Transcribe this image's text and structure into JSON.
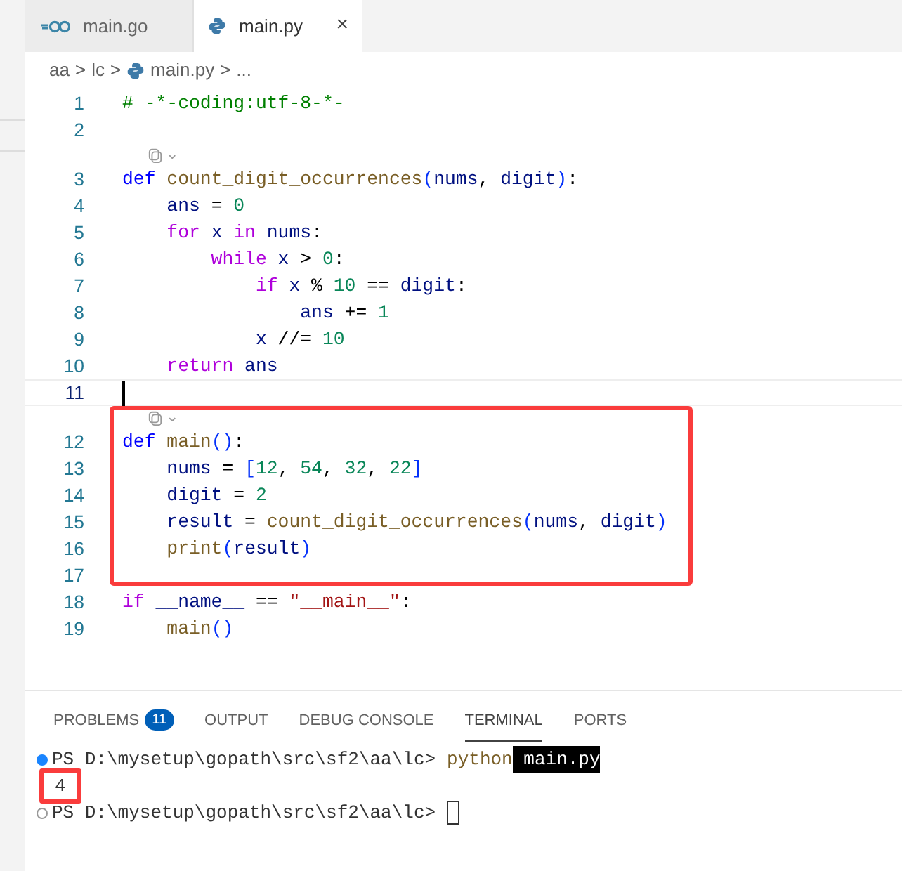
{
  "tabs": [
    {
      "label": "main.go",
      "selected": false
    },
    {
      "label": "main.py",
      "selected": true,
      "close": "×"
    }
  ],
  "breadcrumb": [
    {
      "label": "aa",
      "kind": "folder"
    },
    {
      "label": "lc",
      "kind": "folder"
    },
    {
      "label": "main.py",
      "kind": "file"
    },
    {
      "label": "...",
      "kind": "symbol"
    }
  ],
  "breadcrumb_separator": ">",
  "code": [
    {
      "highlighted": false,
      "lines": [
        {
          "kind": "line",
          "number": "1",
          "current": false,
          "tokens": [
            {
              "t": "# -*-coding:utf-8-*-",
              "color": "#008000"
            }
          ]
        },
        {
          "kind": "line",
          "number": "2",
          "current": false
        },
        {
          "kind": "codelens",
          "caret": "⌄"
        },
        {
          "kind": "line",
          "number": "3",
          "current": false,
          "tokens": [
            {
              "t": "def",
              "color": "#0000ff"
            },
            {
              "t": " count_digit_occurrences",
              "color": "#795e26"
            },
            {
              "t": "(",
              "color": "#0431fa"
            },
            {
              "t": "nums",
              "color": "#001080"
            },
            {
              "t": ", ",
              "color": "#000000"
            },
            {
              "t": "digit",
              "color": "#001080"
            },
            {
              "t": ")",
              "color": "#0431fa"
            },
            {
              "t": ":",
              "color": "#000000"
            }
          ]
        },
        {
          "kind": "line",
          "number": "4",
          "current": false,
          "tokens": [
            {
              "t": "    ans",
              "color": "#001080"
            },
            {
              "t": " = ",
              "color": "#000000"
            },
            {
              "t": "0",
              "color": "#098658"
            }
          ]
        },
        {
          "kind": "line",
          "number": "5",
          "current": false,
          "tokens": [
            {
              "t": "    for",
              "color": "#af00db"
            },
            {
              "t": " x",
              "color": "#001080"
            },
            {
              "t": " in",
              "color": "#af00db"
            },
            {
              "t": " nums",
              "color": "#001080"
            },
            {
              "t": ":",
              "color": "#000000"
            }
          ]
        },
        {
          "kind": "line",
          "number": "6",
          "current": false,
          "tokens": [
            {
              "t": "        while",
              "color": "#af00db"
            },
            {
              "t": " x",
              "color": "#001080"
            },
            {
              "t": " > ",
              "color": "#000000"
            },
            {
              "t": "0",
              "color": "#098658"
            },
            {
              "t": ":",
              "color": "#000000"
            }
          ]
        },
        {
          "kind": "line",
          "number": "7",
          "current": false,
          "tokens": [
            {
              "t": "            if",
              "color": "#af00db"
            },
            {
              "t": " x",
              "color": "#001080"
            },
            {
              "t": " % ",
              "color": "#000000"
            },
            {
              "t": "10",
              "color": "#098658"
            },
            {
              "t": " == ",
              "color": "#000000"
            },
            {
              "t": "digit",
              "color": "#001080"
            },
            {
              "t": ":",
              "color": "#000000"
            }
          ]
        },
        {
          "kind": "line",
          "number": "8",
          "current": false,
          "tokens": [
            {
              "t": "                ans",
              "color": "#001080"
            },
            {
              "t": " += ",
              "color": "#000000"
            },
            {
              "t": "1",
              "color": "#098658"
            }
          ]
        },
        {
          "kind": "line",
          "number": "9",
          "current": false,
          "tokens": [
            {
              "t": "            x",
              "color": "#001080"
            },
            {
              "t": " //= ",
              "color": "#000000"
            },
            {
              "t": "10",
              "color": "#098658"
            }
          ]
        },
        {
          "kind": "line",
          "number": "10",
          "current": false,
          "tokens": [
            {
              "t": "    return",
              "color": "#af00db"
            },
            {
              "t": " ans",
              "color": "#001080"
            }
          ]
        },
        {
          "kind": "line",
          "number": "11",
          "current": true
        }
      ]
    },
    {
      "highlighted": true,
      "lines": [
        {
          "kind": "codelens",
          "caret": "⌄"
        },
        {
          "kind": "line",
          "number": "12",
          "current": false,
          "tokens": [
            {
              "t": "def",
              "color": "#0000ff"
            },
            {
              "t": " main",
              "color": "#795e26"
            },
            {
              "t": "()",
              "color": "#0431fa"
            },
            {
              "t": ":",
              "color": "#000000"
            }
          ]
        },
        {
          "kind": "line",
          "number": "13",
          "current": false,
          "tokens": [
            {
              "t": "    nums",
              "color": "#001080"
            },
            {
              "t": " = ",
              "color": "#000000"
            },
            {
              "t": "[",
              "color": "#0431fa"
            },
            {
              "t": "12",
              "color": "#098658"
            },
            {
              "t": ", ",
              "color": "#000000"
            },
            {
              "t": "54",
              "color": "#098658"
            },
            {
              "t": ", ",
              "color": "#000000"
            },
            {
              "t": "32",
              "color": "#098658"
            },
            {
              "t": ", ",
              "color": "#000000"
            },
            {
              "t": "22",
              "color": "#098658"
            },
            {
              "t": "]",
              "color": "#0431fa"
            }
          ]
        },
        {
          "kind": "line",
          "number": "14",
          "current": false,
          "tokens": [
            {
              "t": "    digit",
              "color": "#001080"
            },
            {
              "t": " = ",
              "color": "#000000"
            },
            {
              "t": "2",
              "color": "#098658"
            }
          ]
        },
        {
          "kind": "line",
          "number": "15",
          "current": false,
          "tokens": [
            {
              "t": "    result",
              "color": "#001080"
            },
            {
              "t": " = ",
              "color": "#000000"
            },
            {
              "t": "count_digit_occurrences",
              "color": "#795e26"
            },
            {
              "t": "(",
              "color": "#0431fa"
            },
            {
              "t": "nums",
              "color": "#001080"
            },
            {
              "t": ", ",
              "color": "#000000"
            },
            {
              "t": "digit",
              "color": "#001080"
            },
            {
              "t": ")",
              "color": "#0431fa"
            }
          ]
        },
        {
          "kind": "line",
          "number": "16",
          "current": false,
          "tokens": [
            {
              "t": "    print",
              "color": "#795e26"
            },
            {
              "t": "(",
              "color": "#0431fa"
            },
            {
              "t": "result",
              "color": "#001080"
            },
            {
              "t": ")",
              "color": "#0431fa"
            }
          ]
        },
        {
          "kind": "line",
          "number": "17",
          "current": false
        }
      ]
    },
    {
      "highlighted": false,
      "lines": [
        {
          "kind": "line",
          "number": "18",
          "current": false,
          "tokens": [
            {
              "t": "if",
              "color": "#af00db"
            },
            {
              "t": " __name__",
              "color": "#001080"
            },
            {
              "t": " == ",
              "color": "#000000"
            },
            {
              "t": "\"__main__\"",
              "color": "#a31515"
            },
            {
              "t": ":",
              "color": "#000000"
            }
          ]
        },
        {
          "kind": "line",
          "number": "19",
          "current": false,
          "tokens": [
            {
              "t": "    main",
              "color": "#795e26"
            },
            {
              "t": "()",
              "color": "#0431fa"
            }
          ]
        }
      ]
    }
  ],
  "panel_tabs": [
    {
      "label": "PROBLEMS",
      "badge": "11",
      "selected": false
    },
    {
      "label": "OUTPUT",
      "selected": false
    },
    {
      "label": "DEBUG CONSOLE",
      "selected": false
    },
    {
      "label": "TERMINAL",
      "selected": true
    },
    {
      "label": "PORTS",
      "selected": false
    }
  ],
  "terminal": [
    {
      "kind": "command",
      "prompt": "PS D:\\mysetup\\gopath\\src\\sf2\\aa\\lc>",
      "command": "python",
      "argument": " main.py"
    },
    {
      "kind": "output",
      "text": "4",
      "highlighted": true
    },
    {
      "kind": "prompt",
      "prompt": "PS D:\\mysetup\\gopath\\src\\sf2\\aa\\lc>"
    }
  ]
}
